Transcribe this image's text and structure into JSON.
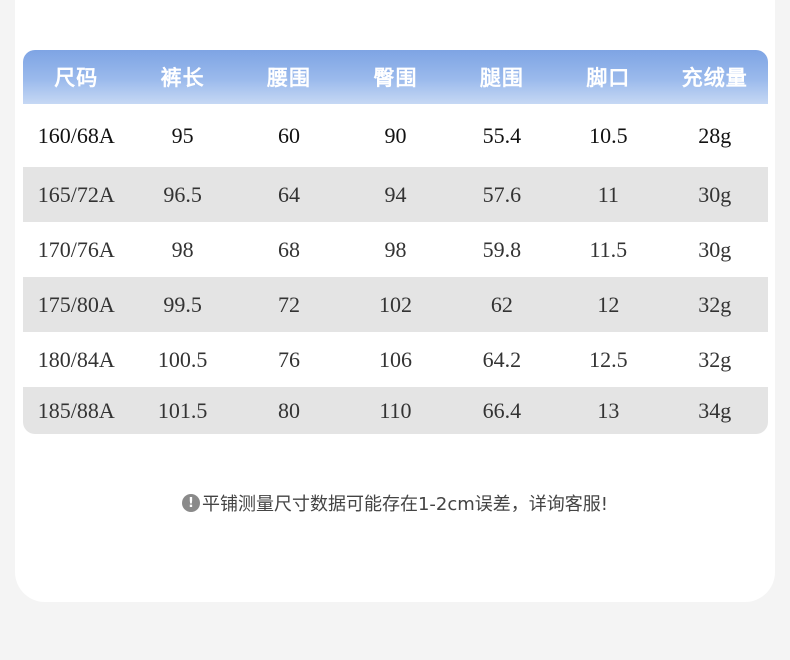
{
  "table": {
    "headers": [
      "尺码",
      "裤长",
      "腰围",
      "臀围",
      "腿围",
      "脚口",
      "充绒量"
    ],
    "rows": [
      [
        "160/68A",
        "95",
        "60",
        "90",
        "55.4",
        "10.5",
        "28g"
      ],
      [
        "165/72A",
        "96.5",
        "64",
        "94",
        "57.6",
        "11",
        "30g"
      ],
      [
        "170/76A",
        "98",
        "68",
        "98",
        "59.8",
        "11.5",
        "30g"
      ],
      [
        "175/80A",
        "99.5",
        "72",
        "102",
        "62",
        "12",
        "32g"
      ],
      [
        "180/84A",
        "100.5",
        "76",
        "106",
        "64.2",
        "12.5",
        "32g"
      ],
      [
        "185/88A",
        "101.5",
        "80",
        "110",
        "66.4",
        "13",
        "34g"
      ]
    ]
  },
  "note": {
    "icon": "exclamation-circle-icon",
    "icon_glyph": "!",
    "text": "平铺测量尺寸数据可能存在1-2cm误差，详询客服!"
  },
  "colors": {
    "header_top": "#7ea4e4",
    "header_bottom": "#c6d8f4",
    "stripe": "#e4e4e4"
  }
}
